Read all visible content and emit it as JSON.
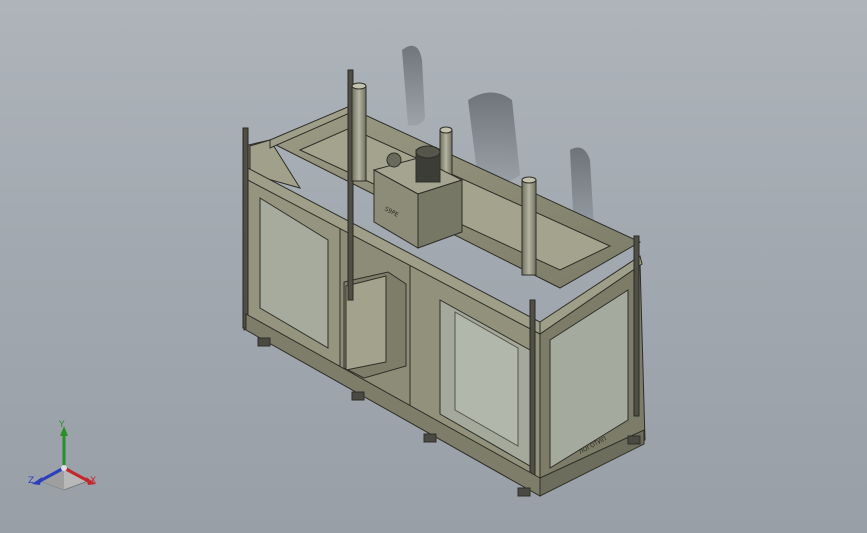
{
  "viewport": {
    "background_top": "#aeb4ba",
    "background_bottom": "#999fa7",
    "model_color": "#8f8f7a",
    "model_name_visible": false
  },
  "model": {
    "plate_text": "ЛОГОТИП",
    "pump_label": "S9PE"
  },
  "triad": {
    "x_label": "X",
    "y_label": "Y",
    "z_label": "Z",
    "x_color": "#c4262b",
    "y_color": "#2a8f2a",
    "z_color": "#2b3fbf"
  }
}
